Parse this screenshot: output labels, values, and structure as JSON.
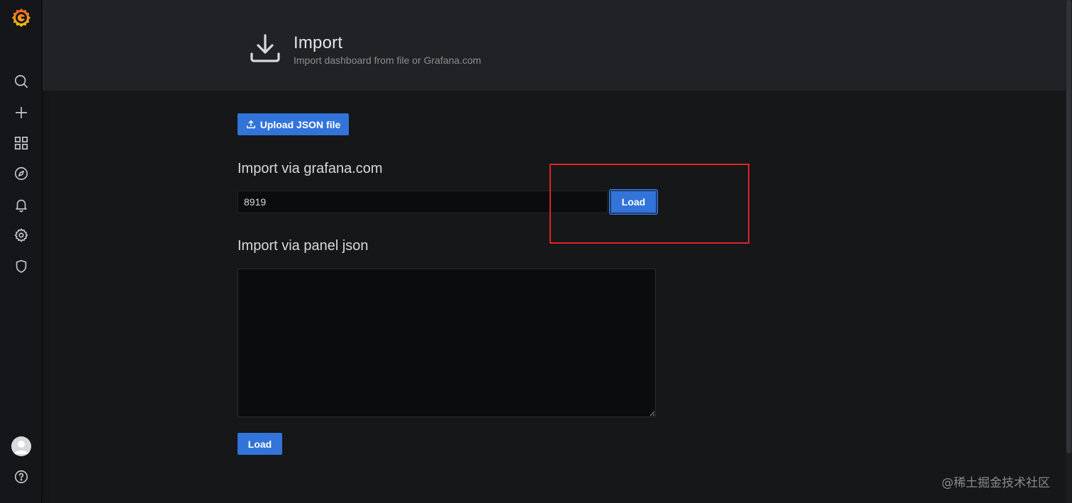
{
  "header": {
    "title": "Import",
    "subtitle": "Import dashboard from file or Grafana.com",
    "icon": "download-icon"
  },
  "sidebar": {
    "logo": "grafana-logo",
    "items": [
      {
        "name": "search",
        "icon": "search-icon"
      },
      {
        "name": "create",
        "icon": "plus-icon"
      },
      {
        "name": "dashboards",
        "icon": "apps-icon"
      },
      {
        "name": "explore",
        "icon": "compass-icon"
      },
      {
        "name": "alerting",
        "icon": "bell-icon"
      },
      {
        "name": "configuration",
        "icon": "gear-icon"
      },
      {
        "name": "server-admin",
        "icon": "shield-icon"
      }
    ],
    "bottom": [
      {
        "name": "profile",
        "icon": "avatar-icon"
      },
      {
        "name": "help",
        "icon": "question-circle-icon"
      }
    ]
  },
  "upload": {
    "label": "Upload JSON file",
    "icon": "upload-icon"
  },
  "grafana_com": {
    "heading": "Import via grafana.com",
    "value": "8919",
    "load_label": "Load"
  },
  "panel_json": {
    "heading": "Import via panel json",
    "value": "",
    "load_label": "Load"
  },
  "watermark": "@稀土掘金技术社区",
  "colors": {
    "primary_button": "#3274d9",
    "background": "#161719",
    "header_bg": "#202226",
    "annotation": "#e02424"
  }
}
